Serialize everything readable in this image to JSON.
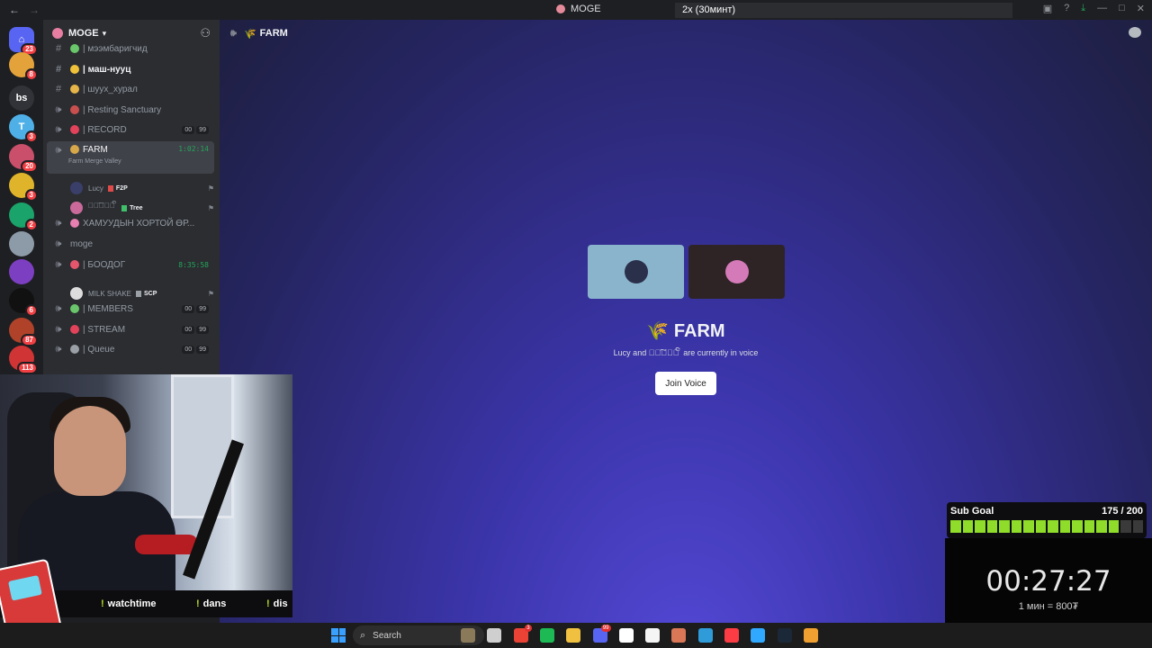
{
  "titlebar": {
    "back_icon": "arrow-left-icon",
    "forward_icon": "arrow-right-icon",
    "title": "MOGE",
    "notification": "2x (30минт)",
    "icons": [
      "inbox-icon",
      "help-icon",
      "download-icon",
      "minimize-icon",
      "maximize-icon",
      "close-icon"
    ]
  },
  "rail": {
    "servers": [
      {
        "label": "",
        "badge": "23",
        "color": "#5865f2"
      },
      {
        "label": "",
        "badge": "8",
        "color": "#e4a23a"
      },
      {
        "label": "bs",
        "badge": "",
        "color": "#313338"
      },
      {
        "label": "T",
        "badge": "3",
        "color": "#4fb0e8"
      },
      {
        "label": "",
        "badge": "20",
        "color": "#c94f6a"
      },
      {
        "label": "",
        "badge": "3",
        "color": "#e0b42a"
      },
      {
        "label": "",
        "badge": "2",
        "color": "#1aa36a"
      },
      {
        "label": "",
        "badge": "",
        "color": "#8d9aa8"
      },
      {
        "label": "",
        "badge": "",
        "color": "#7d3fc2"
      },
      {
        "label": "",
        "badge": "6",
        "color": "#111111"
      },
      {
        "label": "",
        "badge": "87",
        "color": "#b0422a"
      },
      {
        "label": "",
        "badge": "113",
        "color": "#d13434"
      }
    ]
  },
  "sidebar": {
    "server_name": "MOGE",
    "channels": [
      {
        "type": "text",
        "emoji_color": "#6ac66a",
        "name": "| мээмбаригчид"
      },
      {
        "type": "text",
        "emoji_color": "#f0c23a",
        "name": "| маш-нууц"
      },
      {
        "type": "text",
        "emoji_color": "#e6b54a",
        "name": "| шуух_хурал"
      },
      {
        "type": "voice",
        "emoji_color": "#c94f4f",
        "name": "| Resting Sanctuary"
      },
      {
        "type": "voice",
        "emoji_color": "#e2425a",
        "name": "| RECORD",
        "counts": [
          "00",
          "99"
        ]
      },
      {
        "type": "voice",
        "emoji_color": "#d6a84a",
        "name": "FARM",
        "timer": "1:02:14",
        "sub": "Farm Merge Valley"
      },
      {
        "type": "voice",
        "emoji_color": "#e77fb0",
        "name": "ХАМУУДЫН ХОРТОЙ ӨР..."
      },
      {
        "type": "voice",
        "emoji_color": "",
        "name": "moge"
      },
      {
        "type": "voice",
        "emoji_color": "#e5566c",
        "name": "| БООДОГ",
        "timer": "8:35:58"
      },
      {
        "type": "voice",
        "emoji_color": "#6ac66a",
        "name": "| MEMBERS",
        "counts": [
          "00",
          "99"
        ]
      },
      {
        "type": "voice",
        "emoji_color": "#e2425a",
        "name": "| STREAM",
        "counts": [
          "00",
          "99"
        ]
      },
      {
        "type": "voice",
        "emoji_color": "#9aa0a6",
        "name": "| Queue",
        "counts": [
          "00",
          "99"
        ]
      }
    ],
    "farm_users": [
      {
        "name": "Lucy",
        "tag": "F2P",
        "tag_color": "#e04a4a",
        "avatar": "#3a3f6a"
      },
      {
        "name": "ꦼꦁ͠ꦾꦺꦴ ꦼꦁ",
        "tag": "Tree",
        "tag_color": "#3fbf6a",
        "avatar": "#c96a9a"
      }
    ],
    "boodog_users": [
      {
        "name": "MILK SHAKE",
        "tag": "SCP",
        "tag_color": "#9aa0a6",
        "avatar": "#dddddd"
      }
    ]
  },
  "main": {
    "channel_name": "FARM",
    "title": "FARM",
    "subtitle": "Lucy and ꦼꦁ͠ꦾꦺꦴ ꦼꦁ are currently in voice",
    "join_label": "Join Voice",
    "tiles": [
      {
        "bg": "#8ab4cc",
        "avatar": "#2a2f4a"
      },
      {
        "bg": "#2e2426",
        "avatar": "#d47ab8"
      }
    ]
  },
  "overlay": {
    "commands": [
      "watchtime",
      "dans",
      "dis"
    ],
    "sub_goal": {
      "label": "Sub Goal",
      "value": "175 / 200",
      "progress": 0.875,
      "segments": 16
    },
    "timer": "00:27:27",
    "rate": "1 мин = 800₮"
  },
  "taskbar": {
    "search_label": "Search",
    "apps": [
      {
        "name": "photos-icon",
        "color": "#8a7a5a",
        "badge": ""
      },
      {
        "name": "settings-icon",
        "color": "#cfcfcf",
        "badge": ""
      },
      {
        "name": "chrome-icon",
        "color": "#ea4335",
        "badge": "3"
      },
      {
        "name": "spotify-icon",
        "color": "#1db954",
        "badge": ""
      },
      {
        "name": "file-explorer-icon",
        "color": "#f0c040",
        "badge": ""
      },
      {
        "name": "discord-icon",
        "color": "#5865f2",
        "badge": "99"
      },
      {
        "name": "capcut-icon",
        "color": "#ffffff",
        "badge": ""
      },
      {
        "name": "notion-icon",
        "color": "#f5f5f5",
        "badge": ""
      },
      {
        "name": "claude-icon",
        "color": "#d97757",
        "badge": ""
      },
      {
        "name": "edge-icon",
        "color": "#2f9bd9",
        "badge": ""
      },
      {
        "name": "music-icon",
        "color": "#fc3c44",
        "badge": ""
      },
      {
        "name": "photoshop-icon",
        "color": "#31a8ff",
        "badge": ""
      },
      {
        "name": "steam-icon",
        "color": "#1b2838",
        "badge": ""
      },
      {
        "name": "chrome-canary-icon",
        "color": "#f0a030",
        "badge": ""
      }
    ]
  }
}
